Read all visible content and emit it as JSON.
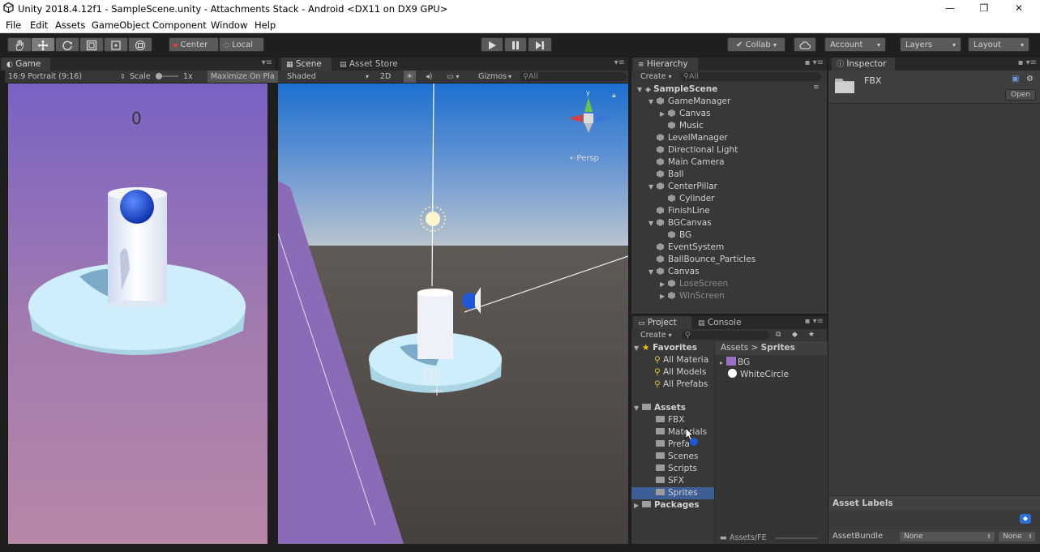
{
  "window": {
    "title": "Unity 2018.4.12f1 - SampleScene.unity - Attachments Stack - Android <DX11 on DX9 GPU>",
    "minimize": "—",
    "maximize": "❐",
    "close": "✕"
  },
  "menu": [
    "File",
    "Edit",
    "Assets",
    "GameObject",
    "Component",
    "Window",
    "Help"
  ],
  "toolbar": {
    "tools": [
      "hand-tool",
      "move-tool",
      "rotate-tool",
      "scale-tool",
      "rect-tool"
    ],
    "pivot": "Center",
    "space": "Local",
    "collab": "Collab",
    "account": "Account",
    "layers": "Layers",
    "layout": "Layout"
  },
  "game": {
    "tab": "Game",
    "aspect": "16:9 Portrait (9:16)",
    "scale_label": "Scale",
    "scale_value": "1x",
    "maximize": "Maximize On Pla",
    "score": "0"
  },
  "scene": {
    "tab": "Scene",
    "tab2": "Asset Store",
    "shading": "Shaded",
    "mode2d": "2D",
    "gizmos": "Gizmos",
    "search": "All",
    "persp": "Persp"
  },
  "hierarchy": {
    "tab": "Hierarchy",
    "create": "Create",
    "search": "All",
    "scene": "SampleScene",
    "items": [
      {
        "label": "GameManager",
        "depth": 1,
        "arrow": "▼"
      },
      {
        "label": "Canvas",
        "depth": 2,
        "arrow": "▶"
      },
      {
        "label": "Music",
        "depth": 2,
        "arrow": ""
      },
      {
        "label": "LevelManager",
        "depth": 1,
        "arrow": ""
      },
      {
        "label": "Directional Light",
        "depth": 1,
        "arrow": ""
      },
      {
        "label": "Main Camera",
        "depth": 1,
        "arrow": ""
      },
      {
        "label": "Ball",
        "depth": 1,
        "arrow": ""
      },
      {
        "label": "CenterPillar",
        "depth": 1,
        "arrow": "▼"
      },
      {
        "label": "Cylinder",
        "depth": 2,
        "arrow": ""
      },
      {
        "label": "FinishLine",
        "depth": 1,
        "arrow": ""
      },
      {
        "label": "BGCanvas",
        "depth": 1,
        "arrow": "▼"
      },
      {
        "label": "BG",
        "depth": 2,
        "arrow": ""
      },
      {
        "label": "EventSystem",
        "depth": 1,
        "arrow": ""
      },
      {
        "label": "BallBounce_Particles",
        "depth": 1,
        "arrow": ""
      },
      {
        "label": "Canvas",
        "depth": 1,
        "arrow": "▼"
      },
      {
        "label": "LoseScreen",
        "depth": 2,
        "arrow": "▶",
        "dim": true
      },
      {
        "label": "WinScreen",
        "depth": 2,
        "arrow": "▶",
        "dim": true
      }
    ]
  },
  "project": {
    "tab": "Project",
    "tab2": "Console",
    "create": "Create",
    "favorites": "Favorites",
    "fav_items": [
      "All Materia",
      "All Models",
      "All Prefabs"
    ],
    "assets": "Assets",
    "folders": [
      "FBX",
      "Materials",
      "Prefa",
      "Scenes",
      "Scripts",
      "SFX",
      "Sprites"
    ],
    "selected_folder": "Sprites",
    "packages": "Packages",
    "breadcrumb_root": "Assets",
    "breadcrumb_sep": ">",
    "breadcrumb_leaf": "Sprites",
    "files": [
      "BG",
      "WhiteCircle"
    ],
    "footer_path": "Assets/FE"
  },
  "inspector": {
    "tab": "Inspector",
    "name": "FBX",
    "open": "Open",
    "asset_labels": "Asset Labels",
    "asset_bundle": "AssetBundle",
    "bundle_value": "None",
    "bundle_variant": "None"
  },
  "colors": {
    "accent_selection": "#3e5f96",
    "ball": "#1f57d6",
    "disc": "#cdeefa"
  }
}
